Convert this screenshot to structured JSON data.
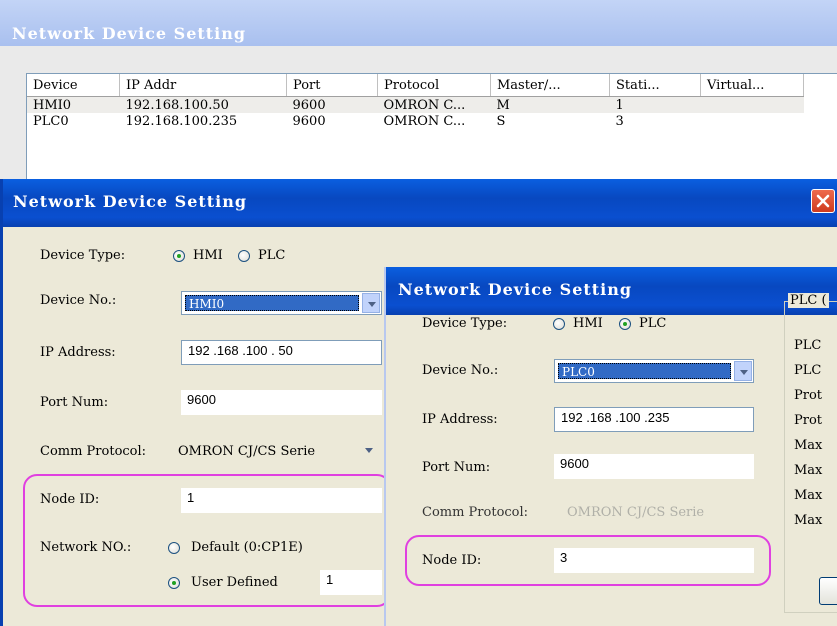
{
  "back_window": {
    "title": "Network Device Setting",
    "columns": [
      "Device",
      "IP Addr",
      "Port",
      "Protocol",
      "Master/...",
      "Stati...",
      "Virtual..."
    ],
    "rows": [
      [
        "HMI0",
        "192.168.100.50",
        "9600",
        "OMRON C...",
        "M",
        "1",
        ""
      ],
      [
        "PLC0",
        "192.168.100.235",
        "9600",
        "OMRON C...",
        "S",
        "3",
        ""
      ]
    ]
  },
  "hmi_dialog": {
    "title": "Network Device Setting",
    "device_type_label": "Device Type:",
    "opt_hmi": "HMI",
    "opt_plc": "PLC",
    "device_no_label": "Device No.:",
    "device_no_value": "HMI0",
    "ip_label": "IP Address:",
    "ip_value": "192 .168 .100 . 50",
    "port_label": "Port Num:",
    "port_value": "9600",
    "protocol_label": "Comm Protocol:",
    "protocol_value": "OMRON CJ/CS Serie",
    "node_label": "Node ID:",
    "node_value": "1",
    "network_label": "Network NO.:",
    "network_default": "Default (0:CP1E)",
    "network_user": "User Defined",
    "network_user_value": "1"
  },
  "plc_dialog": {
    "title": "Network Device Setting",
    "device_type_label": "Device Type:",
    "opt_hmi": "HMI",
    "opt_plc": "PLC",
    "device_no_label": "Device No.:",
    "device_no_value": "PLC0",
    "ip_label": "IP Address:",
    "ip_value": "192 .168 .100 .235",
    "port_label": "Port Num:",
    "port_value": "9600",
    "protocol_label": "Comm Protocol:",
    "protocol_value": "OMRON CJ/CS Serie",
    "node_label": "Node ID:",
    "node_value": "3",
    "group_title": "PLC (",
    "group_items": [
      "PLC",
      "PLC",
      "Prot",
      "Prot",
      "Max",
      "Max",
      "Max",
      "Max"
    ]
  },
  "colors": {
    "title_active": "#0a5fe0",
    "title_inactive": "#c3d4f6",
    "dialog_bg": "#ece9d8",
    "highlight": "#e040e0",
    "close_button": "#e0442b"
  }
}
